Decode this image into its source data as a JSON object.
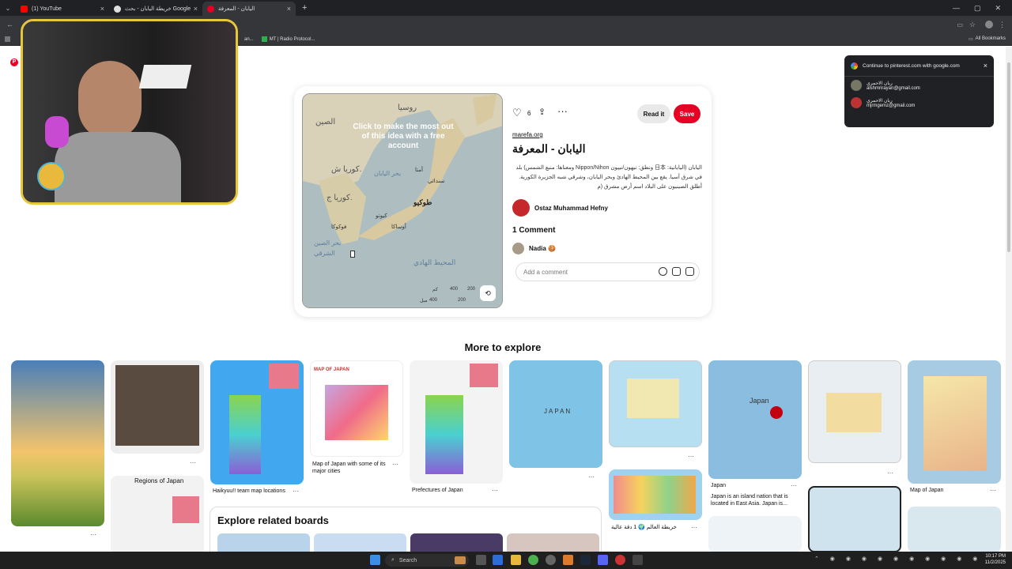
{
  "browser": {
    "tabs": [
      {
        "label": "(1) YouTube",
        "color": "#ff0000"
      },
      {
        "label": "خريطة اليابان - بحث Google",
        "color": "#e0e0e0"
      },
      {
        "label": "اليابان - المعرفة",
        "color": "#e60023"
      }
    ],
    "bookmarks": [
      {
        "label": "an..."
      },
      {
        "label": "MT | Radio Protocol..."
      }
    ],
    "all_bookmarks": "All Bookmarks"
  },
  "pin": {
    "overlay_text": "Click to make the most out of this idea with a free account",
    "like_count": "6",
    "read_it": "Read it",
    "save": "Save",
    "source": "marefa.org",
    "title": "اليابان - المعرفة",
    "description": "اليابان (اليابانية: 日本 ونطق: نيهون/نيپون Nippon/Nihon ومعناها: منبع الشمس) بلد في شرق آسيا. يقع بين المحيط الهادئ وبحر اليابان، وشرقي شبه الجزيرة الكورية. أطلق الصينيون على البلاد اسم أرض مشرق (م",
    "author": "Ostaz Muhammad Hefny",
    "comments_heading": "1 Comment",
    "commenter": "Nadia 🍪",
    "comment_placeholder": "Add a comment",
    "accent_color": "#e60023"
  },
  "map_labels": [
    "روسيا",
    "الصين",
    "كوريا ش.",
    "كوريا ج.",
    "بحر اليابان",
    "أمتا",
    "سندائي",
    "طوكيو",
    "كيوتو",
    "أوساكا",
    "فوكوكا",
    "المحيط الهادي",
    "بحر الصين الشرقي",
    "كم",
    "ميل",
    "400",
    "200",
    "400",
    "200"
  ],
  "google_popup": {
    "title": "Continue to pinterest.com with google.com",
    "accounts": [
      {
        "name": "ريان الاحمري",
        "email": "alshmrirayan@gmail.com"
      },
      {
        "name": "ريان الاحمري",
        "email": "mjrmgemz@gmail.com"
      }
    ]
  },
  "explore": {
    "heading": "More to explore",
    "captions": [
      "Haikyuu!! team map locations",
      "Map of Japan with some of its major cities",
      "Prefectures of Japan",
      "Japan",
      "Japan is an island nation that is located in East Asia. Japan is...",
      "Map of Japan",
      "خريطة العالم 🌍 1 دقة عالية",
      "Regions of Japan"
    ],
    "boards_heading": "Explore related boards",
    "map_title_in_tile": "MAP OF JAPAN",
    "japan_label": "Japan",
    "japan_label_caps": "JAPAN"
  },
  "taskbar": {
    "search": "Search",
    "time": "10:17 PM",
    "date": "11/2/2025"
  }
}
